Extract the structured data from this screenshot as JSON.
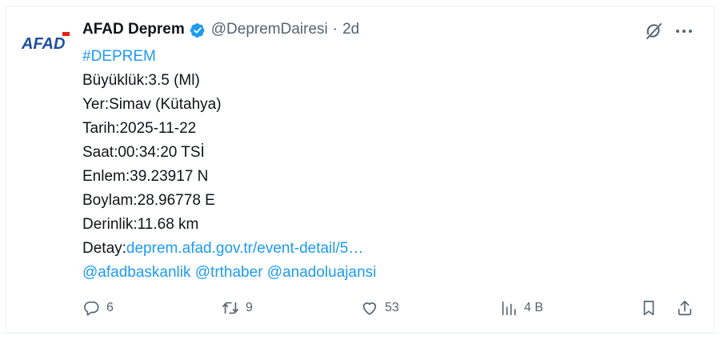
{
  "tweet": {
    "author": {
      "avatar_text": "AFAD",
      "name": "AFAD Deprem",
      "handle": "@DepremDairesi",
      "separator": "·",
      "time": "2d",
      "verified_color": "#1d9bf0"
    },
    "hashtag": "#DEPREM",
    "lines": [
      "Büyüklük:3.5 (Ml)",
      "Yer:Simav (Kütahya)",
      "Tarih:2025-11-22",
      "Saat:00:34:20 TSİ",
      "Enlem:39.23917 N",
      "Boylam:28.96778 E",
      "Derinlik:11.68 km"
    ],
    "detail_label": "Detay:",
    "detail_link": "deprem.afad.gov.tr/event-detail/5…",
    "mentions": "@afadbaskanlik @trthaber @anadoluajansi",
    "actions": {
      "replies": "6",
      "retweets": "9",
      "likes": "53",
      "views": "4 B"
    },
    "colors": {
      "text": "#0f1419",
      "secondary": "#536471",
      "link": "#1d9bf0",
      "brand_blue": "#1f4e9c",
      "brand_red": "#e2231a"
    },
    "icons": [
      "verified-badge-icon",
      "grok-icon",
      "more-icon",
      "reply-icon",
      "retweet-icon",
      "like-icon",
      "views-icon",
      "bookmark-icon",
      "share-icon"
    ]
  }
}
